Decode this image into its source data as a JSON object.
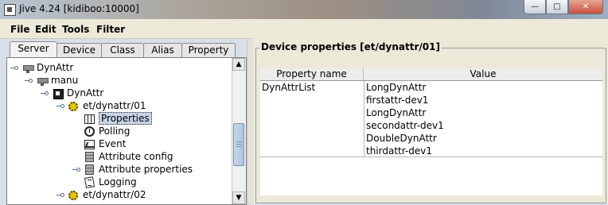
{
  "window": {
    "title": "Jive 4.24  [kidiboo:10000]",
    "minimize": "—",
    "maximize": "□",
    "close": "✕"
  },
  "menu": [
    "File",
    "Edit",
    "Tools",
    "Filter"
  ],
  "tabs": [
    "Server",
    "Device",
    "Class",
    "Alias",
    "Property"
  ],
  "active_tab": "Server",
  "tree": {
    "nodes": [
      {
        "label": "DynAttr",
        "icon": "server-icon"
      },
      {
        "label": "manu",
        "icon": "server-icon"
      },
      {
        "label": "DynAttr",
        "icon": "device-class-icon"
      },
      {
        "label": "et/dynattr/01",
        "icon": "device-gear-icon"
      },
      {
        "label": "Properties",
        "icon": "properties-grid-icon"
      },
      {
        "label": "Polling",
        "icon": "polling-clock-icon"
      },
      {
        "label": "Event",
        "icon": "event-icon"
      },
      {
        "label": "Attribute config",
        "icon": "attribute-config-icon"
      },
      {
        "label": "Attribute properties",
        "icon": "attribute-properties-icon"
      },
      {
        "label": "Logging",
        "icon": "logging-icon"
      },
      {
        "label": "et/dynattr/02",
        "icon": "device-gear-icon"
      }
    ],
    "selected": "Properties"
  },
  "scrollbar": {
    "up": "▲",
    "down": "▼"
  },
  "properties_panel": {
    "title": "Device properties [et/dynattr/01]",
    "columns": [
      "Property name",
      "Value"
    ],
    "rows": [
      {
        "name": "DynAttrList",
        "values": [
          "LongDynAttr",
          "firstattr-dev1",
          "LongDynAttr",
          "secondattr-dev1",
          "DoubleDynAttr",
          "thirdattr-dev1"
        ]
      }
    ]
  }
}
